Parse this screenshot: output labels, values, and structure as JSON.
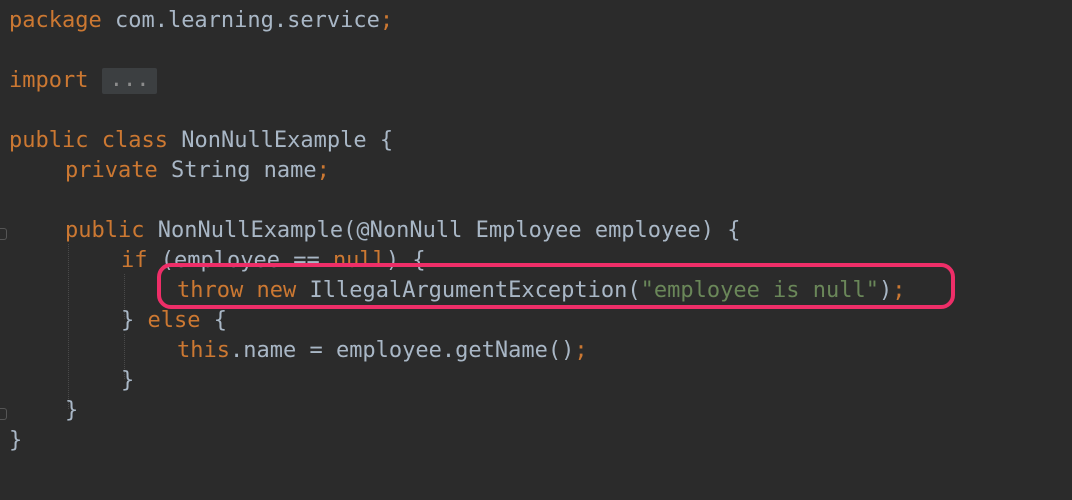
{
  "code": {
    "l1": {
      "kw": "package",
      "rest": " com.learning.service",
      "semi": ";"
    },
    "l3": {
      "kw": "import",
      "fold": "..."
    },
    "l5": {
      "kw1": "public",
      "kw2": "class",
      "rest": " NonNullExample {"
    },
    "l6": {
      "kw": "private",
      "rest": " String name",
      "semi": ";"
    },
    "l8": {
      "kw": "public",
      "rest": " NonNullExample(@NonNull Employee employee) {"
    },
    "l9": {
      "kw1": "if",
      "mid": " (employee == ",
      "kw2": "null",
      "rest": ") {"
    },
    "l10": {
      "kw1": "throw",
      "kw2": "new",
      "rest": " IllegalArgumentException(",
      "str": "\"employee is null\"",
      "close": ")",
      "semi": ";"
    },
    "l11": {
      "open": "} ",
      "kw": "else",
      "rest": " {"
    },
    "l12": {
      "kw": "this",
      "rest": ".name = employee.getName()",
      "semi": ";"
    },
    "l13": {
      "text": "}"
    },
    "l14": {
      "text": "}"
    },
    "l15": {
      "text": "}"
    }
  },
  "colors": {
    "background": "#2b2b2b",
    "keyword": "#cc7832",
    "plain": "#a9b7c6",
    "string": "#6a8759",
    "highlight": "#ee2e68"
  }
}
